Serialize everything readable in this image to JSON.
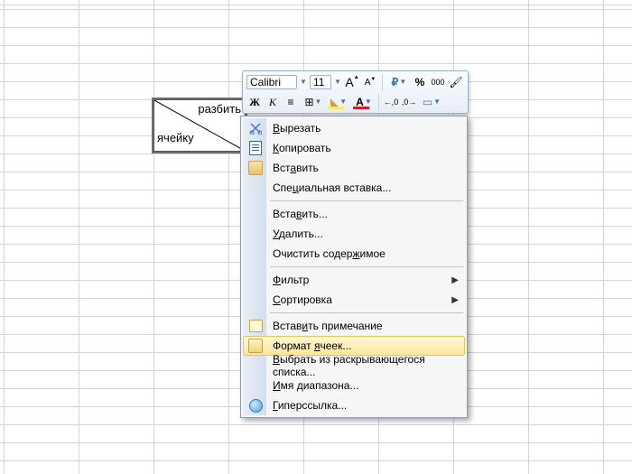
{
  "cell": {
    "top_text": "разбить",
    "bottom_text": "ячейку"
  },
  "mini_toolbar": {
    "font_name": "Calibri",
    "font_size": "11",
    "grow": "A",
    "shrink": "A",
    "percent": "%",
    "thousand": "000",
    "bold": "Ж",
    "italic": "К",
    "center": "≡",
    "borders": "⊞",
    "fill": "◆",
    "font_color": "A",
    "dec_inc": ",0",
    "dec_dec": ",0",
    "format_painter": "✎"
  },
  "context_menu": {
    "items": [
      {
        "icon": "cut",
        "label_pre": "",
        "ul": "В",
        "label_post": "ырезать"
      },
      {
        "icon": "copy",
        "label_pre": "",
        "ul": "К",
        "label_post": "опировать"
      },
      {
        "icon": "paste",
        "label_pre": "Вст",
        "ul": "а",
        "label_post": "вить"
      },
      {
        "label_pre": "Спе",
        "ul": "ц",
        "label_post": "иальная вставка..."
      },
      {
        "sep": true
      },
      {
        "label_pre": "Вста",
        "ul": "в",
        "label_post": "ить..."
      },
      {
        "label_pre": "",
        "ul": "У",
        "label_post": "далить..."
      },
      {
        "label_pre": "Очистить содер",
        "ul": "ж",
        "label_post": "имое"
      },
      {
        "sep": true
      },
      {
        "label_pre": "",
        "ul": "Ф",
        "label_post": "ильтр",
        "submenu": true
      },
      {
        "label_pre": "",
        "ul": "С",
        "label_post": "ортировка",
        "submenu": true
      },
      {
        "sep": true
      },
      {
        "icon": "comment",
        "label_pre": "Встав",
        "ul": "и",
        "label_post": "ть примечание"
      },
      {
        "icon": "format",
        "label_pre": "Формат ",
        "ul": "я",
        "label_post": "чеек...",
        "highlight": true
      },
      {
        "label_pre": "",
        "ul": "В",
        "label_post": "ыбрать из раскрывающегося списка..."
      },
      {
        "label_pre": "",
        "ul": "И",
        "label_post": "мя диапазона..."
      },
      {
        "icon": "link",
        "label_pre": "",
        "ul": "Г",
        "label_post": "иперссылка..."
      }
    ]
  }
}
